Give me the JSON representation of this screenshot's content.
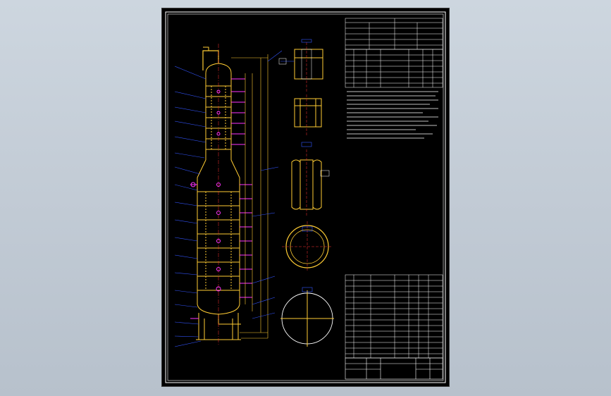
{
  "drawing": {
    "title_block_text": "",
    "sub_text": "",
    "colors": {
      "background": "#c8d1da",
      "sheet": "#000000",
      "border": "#ffffff",
      "vessel": "#ffcc33",
      "dimension": "#3355ff",
      "nozzle": "#ff33ff",
      "centerline": "#ff3333",
      "text": "#ffffff",
      "note": "#ffffff"
    }
  }
}
